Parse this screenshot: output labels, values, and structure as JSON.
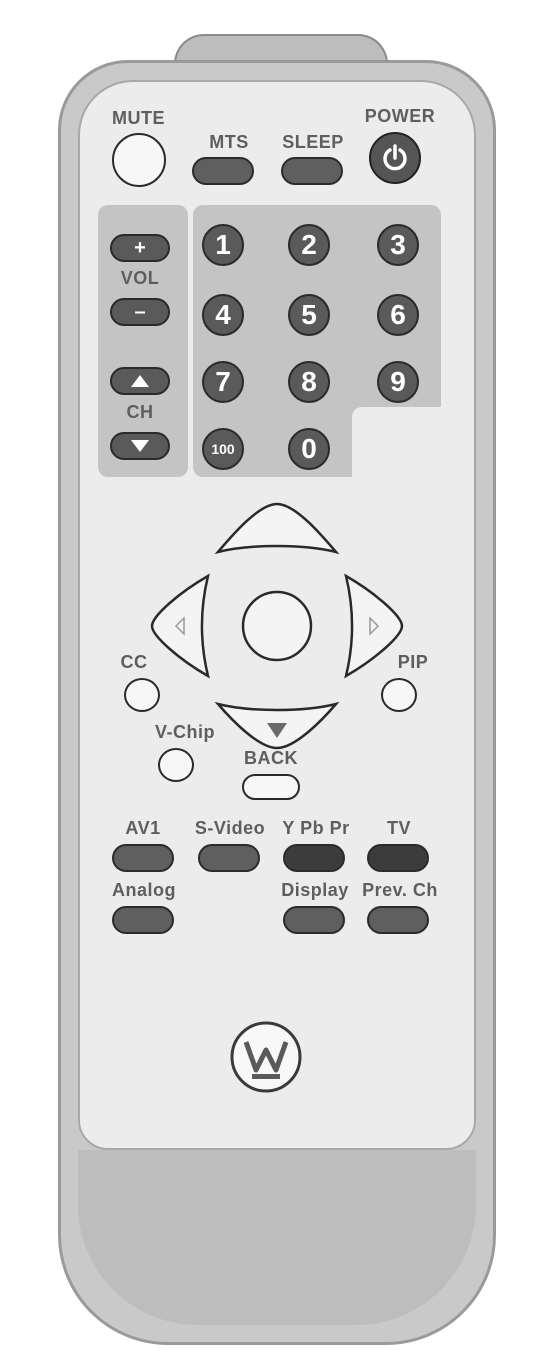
{
  "top_row": {
    "mute_label": "MUTE",
    "mts_label": "MTS",
    "sleep_label": "SLEEP",
    "power_label": "POWER"
  },
  "volume": {
    "label": "VOL",
    "plus_symbol": "+",
    "minus_symbol": "–"
  },
  "channel": {
    "label": "CH"
  },
  "numpad": {
    "keys": [
      "1",
      "2",
      "3",
      "4",
      "5",
      "6",
      "7",
      "8",
      "9",
      "100",
      "0"
    ]
  },
  "navigation": {
    "cc_label": "CC",
    "pip_label": "PIP",
    "vchip_label": "V-Chip",
    "back_label": "BACK"
  },
  "input_row": {
    "av1_label": "AV1",
    "svideo_label": "S-Video",
    "ypbpr_label": "Y Pb Pr",
    "tv_label": "TV"
  },
  "bottom_row": {
    "analog_label": "Analog",
    "display_label": "Display",
    "prev_ch_label": "Prev. Ch"
  },
  "colors": {
    "body": "#c9c9c9",
    "face": "#ececec",
    "button": "#5a5a5a",
    "label": "#5e5e5e"
  },
  "icons": [
    "power-icon",
    "arrow-up-icon",
    "arrow-down-icon",
    "nav-up-icon",
    "nav-down-icon",
    "nav-left-icon",
    "nav-right-icon",
    "brand-logo-icon"
  ]
}
